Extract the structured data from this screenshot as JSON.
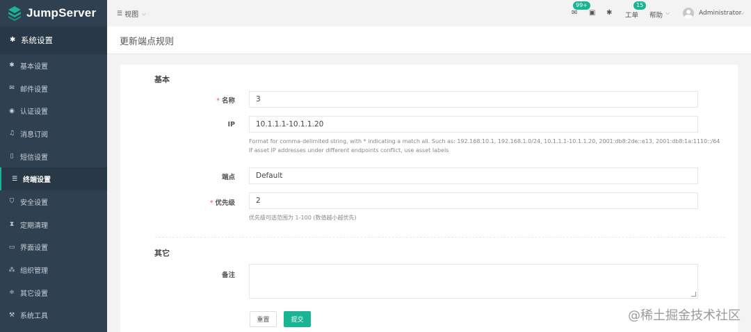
{
  "app": {
    "name": "JumpServer"
  },
  "sidebar": {
    "section": {
      "label": "系统设置",
      "icon": "gear-icon"
    },
    "items": [
      {
        "label": "基本设置",
        "icon": "gear-icon",
        "active": false
      },
      {
        "label": "邮件设置",
        "icon": "envelope-icon",
        "active": false
      },
      {
        "label": "认证设置",
        "icon": "user-circle-icon",
        "active": false
      },
      {
        "label": "消息订阅",
        "icon": "bell-icon",
        "active": false
      },
      {
        "label": "短信设置",
        "icon": "mobile-icon",
        "active": false
      },
      {
        "label": "终端设置",
        "icon": "server-icon",
        "active": true
      },
      {
        "label": "安全设置",
        "icon": "shield-icon",
        "active": false
      },
      {
        "label": "定期清理",
        "icon": "hourglass-icon",
        "active": false
      },
      {
        "label": "界面设置",
        "icon": "laptop-icon",
        "active": false
      },
      {
        "label": "组织管理",
        "icon": "sitemap-icon",
        "active": false
      },
      {
        "label": "其它设置",
        "icon": "sliders-icon",
        "active": false
      },
      {
        "label": "系统工具",
        "icon": "wrench-icon",
        "active": false
      }
    ]
  },
  "topbar": {
    "view_label": "视图",
    "messages_badge": "99+",
    "tickets_label": "工单",
    "tickets_badge": "15",
    "help_label": "帮助",
    "user_name": "Administrator"
  },
  "page": {
    "title": "更新端点规则"
  },
  "form": {
    "section_basic": "基本",
    "name_label": "名称",
    "name_value": "3",
    "ip_label": "IP",
    "ip_value": "10.1.1.1-10.1.1.20",
    "ip_help_1": "Format for comma-delimited string, with * indicating a match all. Such as: 192.168.10.1, 192.168.1.0/24, 10.1.1.1-10.1.1.20, 2001:db8:2de::e13, 2001:db8:1a:1110::/64",
    "ip_help_2": "If asset IP addresses under different endpoints conflict, use asset labels",
    "endpoint_label": "端点",
    "endpoint_value": "Default",
    "priority_label": "优先级",
    "priority_value": "2",
    "priority_help": "优先级可选范围为 1-100 (数值越小越优先)",
    "section_other": "其它",
    "comment_label": "备注",
    "comment_value": "",
    "reset_label": "重置",
    "submit_label": "提交"
  },
  "watermark": "@稀土掘金技术社区",
  "colors": {
    "sidebar": "#2f4050",
    "accent": "#1ab394",
    "required": "#ed5565"
  }
}
